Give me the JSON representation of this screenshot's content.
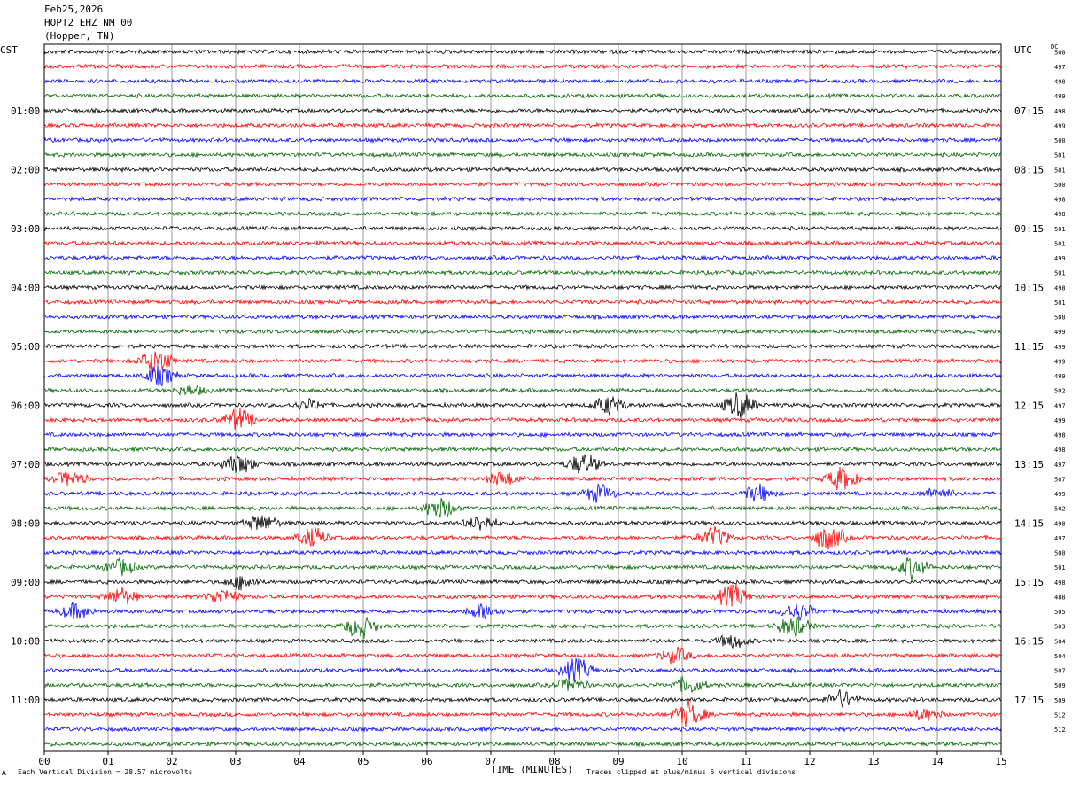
{
  "header": {
    "date": "Feb25,2026",
    "station": "HOPT2 EHZ NM 00",
    "location": "(Hopper, TN)",
    "left_tz": "CST",
    "right_tz": "UTC",
    "dc_label": "DC"
  },
  "footer": {
    "scale_note": "Each Vertical Division =   28.57 microvolts",
    "clip_note": "Traces clipped at plus/minus 5 vertical divisions",
    "corner_mark": "A"
  },
  "colors": [
    "#000000",
    "#ff0000",
    "#0000ff",
    "#006400"
  ],
  "chart_data": {
    "type": "line",
    "title": "",
    "xlabel": "TIME (MINUTES)",
    "ylabel": "",
    "x_ticks": [
      "00",
      "01",
      "02",
      "03",
      "04",
      "05",
      "06",
      "07",
      "08",
      "09",
      "10",
      "11",
      "12",
      "13",
      "14",
      "15"
    ],
    "xlim": [
      0,
      15
    ],
    "left_ticks": [
      "01:00",
      "02:00",
      "03:00",
      "04:00",
      "05:00",
      "06:00",
      "07:00",
      "08:00",
      "09:00",
      "10:00",
      "11:00"
    ],
    "right_ticks": [
      "07:15",
      "08:15",
      "09:15",
      "10:15",
      "11:15",
      "12:15",
      "13:15",
      "14:15",
      "15:15",
      "16:15",
      "17:15"
    ],
    "trace_count": 48,
    "trace_minutes": 15,
    "dc_offsets": [
      "500",
      "497",
      "498",
      "499",
      "498",
      "499",
      "500",
      "501",
      "501",
      "500",
      "498",
      "498",
      "501",
      "501",
      "499",
      "501",
      "498",
      "501",
      "500",
      "499",
      "499",
      "499",
      "499",
      "502",
      "497",
      "499",
      "498",
      "498",
      "497",
      "507",
      "499",
      "502",
      "498",
      "497",
      "500",
      "501",
      "498",
      "488",
      "505",
      "503",
      "504",
      "504",
      "507",
      "509",
      "509",
      "512",
      "512"
    ],
    "events": [
      {
        "trace": 21,
        "minute": 1.75,
        "amp": 3.0
      },
      {
        "trace": 22,
        "minute": 1.8,
        "amp": 2.0
      },
      {
        "trace": 23,
        "minute": 2.3,
        "amp": 1.0
      },
      {
        "trace": 24,
        "minute": 4.15,
        "amp": 1.0
      },
      {
        "trace": 24,
        "minute": 8.85,
        "amp": 2.0
      },
      {
        "trace": 24,
        "minute": 10.9,
        "amp": 2.6
      },
      {
        "trace": 25,
        "minute": 3.05,
        "amp": 2.2
      },
      {
        "trace": 28,
        "minute": 3.05,
        "amp": 2.0
      },
      {
        "trace": 28,
        "minute": 8.45,
        "amp": 2.2
      },
      {
        "trace": 29,
        "minute": 0.4,
        "amp": 1.6
      },
      {
        "trace": 29,
        "minute": 7.2,
        "amp": 1.6
      },
      {
        "trace": 29,
        "minute": 12.5,
        "amp": 2.4
      },
      {
        "trace": 30,
        "minute": 8.7,
        "amp": 1.8
      },
      {
        "trace": 30,
        "minute": 11.2,
        "amp": 1.8
      },
      {
        "trace": 30,
        "minute": 14.0,
        "amp": 1.2
      },
      {
        "trace": 31,
        "minute": 6.2,
        "amp": 2.2
      },
      {
        "trace": 32,
        "minute": 3.4,
        "amp": 1.8
      },
      {
        "trace": 32,
        "minute": 6.85,
        "amp": 1.6
      },
      {
        "trace": 33,
        "minute": 4.2,
        "amp": 2.0
      },
      {
        "trace": 33,
        "minute": 10.5,
        "amp": 2.0
      },
      {
        "trace": 33,
        "minute": 12.3,
        "amp": 2.6
      },
      {
        "trace": 35,
        "minute": 1.2,
        "amp": 1.6
      },
      {
        "trace": 35,
        "minute": 13.6,
        "amp": 2.2
      },
      {
        "trace": 36,
        "minute": 3.1,
        "amp": 1.4
      },
      {
        "trace": 37,
        "minute": 1.2,
        "amp": 1.8
      },
      {
        "trace": 37,
        "minute": 2.8,
        "amp": 1.8
      },
      {
        "trace": 37,
        "minute": 10.8,
        "amp": 2.4
      },
      {
        "trace": 38,
        "minute": 0.5,
        "amp": 1.6
      },
      {
        "trace": 38,
        "minute": 6.9,
        "amp": 1.8
      },
      {
        "trace": 38,
        "minute": 11.8,
        "amp": 2.0
      },
      {
        "trace": 39,
        "minute": 4.95,
        "amp": 2.4
      },
      {
        "trace": 39,
        "minute": 11.75,
        "amp": 2.2
      },
      {
        "trace": 40,
        "minute": 10.8,
        "amp": 1.4
      },
      {
        "trace": 41,
        "minute": 9.9,
        "amp": 1.6
      },
      {
        "trace": 42,
        "minute": 8.35,
        "amp": 2.4
      },
      {
        "trace": 43,
        "minute": 8.25,
        "amp": 1.4
      },
      {
        "trace": 43,
        "minute": 10.1,
        "amp": 1.8
      },
      {
        "trace": 44,
        "minute": 12.5,
        "amp": 1.8
      },
      {
        "trace": 45,
        "minute": 10.1,
        "amp": 2.6
      },
      {
        "trace": 45,
        "minute": 13.8,
        "amp": 1.2
      }
    ]
  }
}
